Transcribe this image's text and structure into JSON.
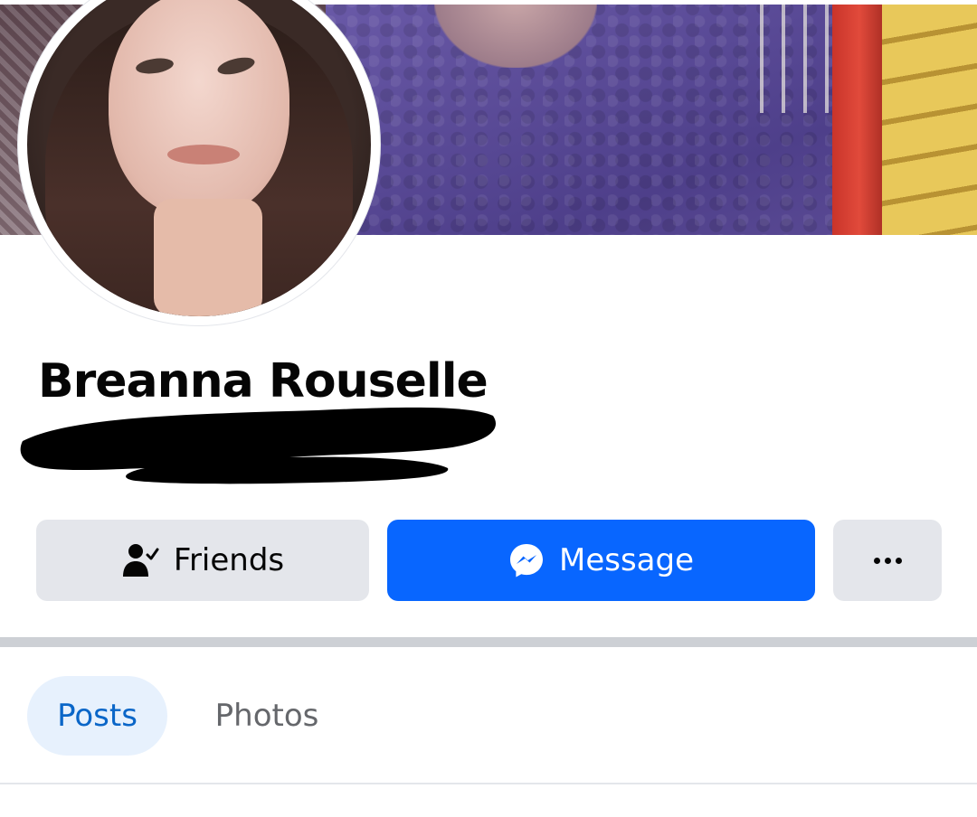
{
  "profile": {
    "name": "Breanna Rouselle"
  },
  "actions": {
    "friends_label": "Friends",
    "message_label": "Message",
    "more_icon": "more-horizontal-icon"
  },
  "tabs": [
    {
      "label": "Posts",
      "active": true
    },
    {
      "label": "Photos",
      "active": false
    }
  ],
  "colors": {
    "message_button": "#0866ff",
    "secondary_button": "#e4e6eb",
    "active_tab_bg": "#e7f1fd",
    "active_tab_text": "#0a66c8",
    "inactive_tab_text": "#65676b"
  },
  "icons": {
    "friends": "friend-check-icon",
    "message": "messenger-icon"
  }
}
